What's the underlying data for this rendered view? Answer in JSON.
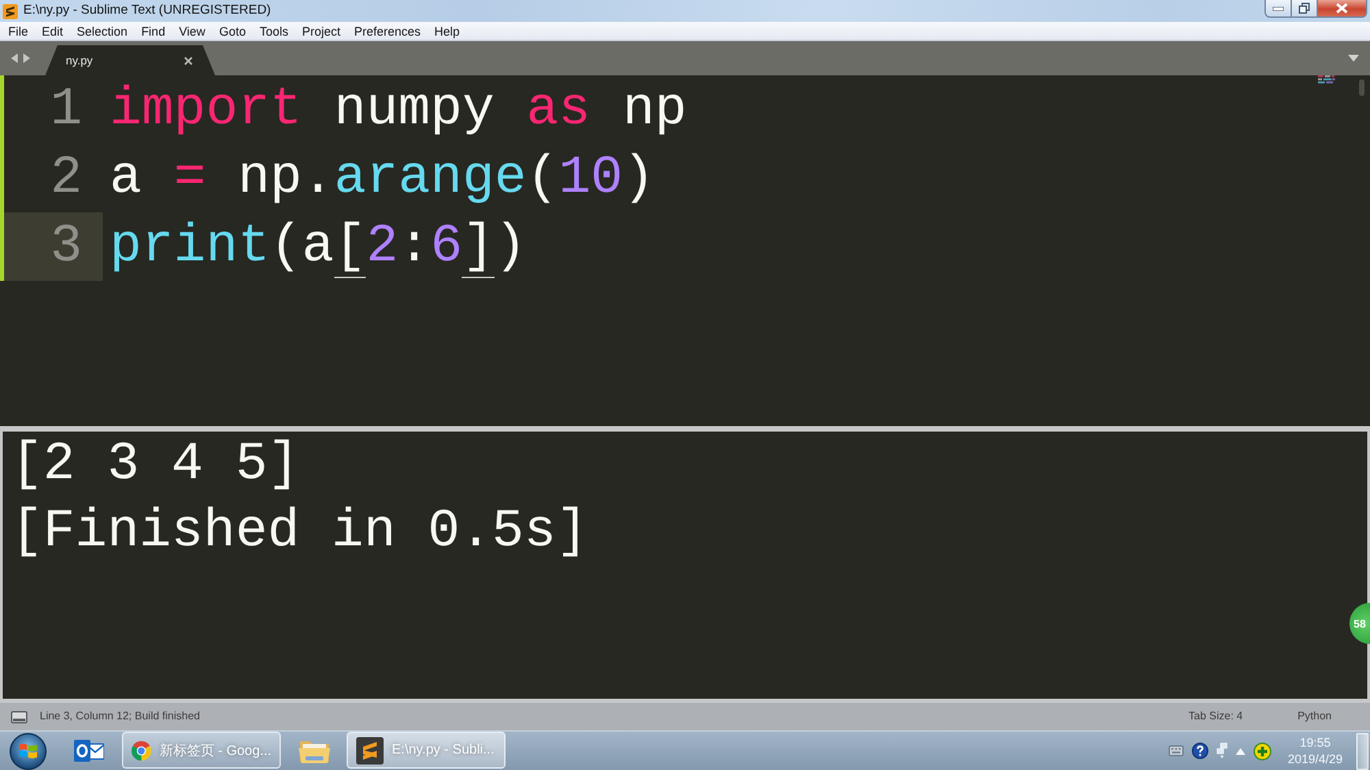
{
  "window": {
    "title": "E:\\ny.py - Sublime Text (UNREGISTERED)"
  },
  "menu": [
    "File",
    "Edit",
    "Selection",
    "Find",
    "View",
    "Goto",
    "Tools",
    "Project",
    "Preferences",
    "Help"
  ],
  "tabs": [
    {
      "label": "ny.py",
      "selected": true
    }
  ],
  "editor": {
    "lines": [
      {
        "number": "1",
        "current": false,
        "modified": true,
        "tokens": [
          {
            "text": "import",
            "kind": "keyword"
          },
          {
            "text": " numpy ",
            "kind": "plain"
          },
          {
            "text": "as",
            "kind": "keyword"
          },
          {
            "text": " np",
            "kind": "plain"
          }
        ]
      },
      {
        "number": "2",
        "current": false,
        "modified": true,
        "tokens": [
          {
            "text": "a ",
            "kind": "plain"
          },
          {
            "text": "=",
            "kind": "operator"
          },
          {
            "text": " np.",
            "kind": "plain"
          },
          {
            "text": "arange",
            "kind": "function"
          },
          {
            "text": "(",
            "kind": "plain"
          },
          {
            "text": "10",
            "kind": "number"
          },
          {
            "text": ")",
            "kind": "plain"
          }
        ]
      },
      {
        "number": "3",
        "current": true,
        "modified": true,
        "tokens": [
          {
            "text": "print",
            "kind": "function"
          },
          {
            "text": "(a",
            "kind": "plain"
          },
          {
            "text": "[",
            "kind": "bracket_match"
          },
          {
            "text": "2",
            "kind": "number"
          },
          {
            "text": ":",
            "kind": "plain"
          },
          {
            "text": "6",
            "kind": "number"
          },
          {
            "text": "]",
            "kind": "bracket_match"
          },
          {
            "text": ")",
            "kind": "plain"
          }
        ]
      }
    ]
  },
  "output": {
    "lines": [
      "[2 3 4 5]",
      "[Finished in 0.5s]"
    ]
  },
  "status_bar": {
    "message": "Line 3, Column 12; Build finished",
    "tab_size": "Tab Size: 4",
    "syntax": "Python"
  },
  "taskbar": {
    "items": [
      {
        "kind": "mail",
        "selected": false
      },
      {
        "kind": "browser",
        "label": "新标签页 - Goog...",
        "selected": false
      },
      {
        "kind": "folder",
        "selected": false
      },
      {
        "kind": "editor",
        "label": "E:\\ny.py - Subli...",
        "selected": true
      }
    ],
    "clock": {
      "time": "19:55",
      "date": "2019/4/29"
    }
  },
  "floating_ball": {
    "label": "58"
  }
}
